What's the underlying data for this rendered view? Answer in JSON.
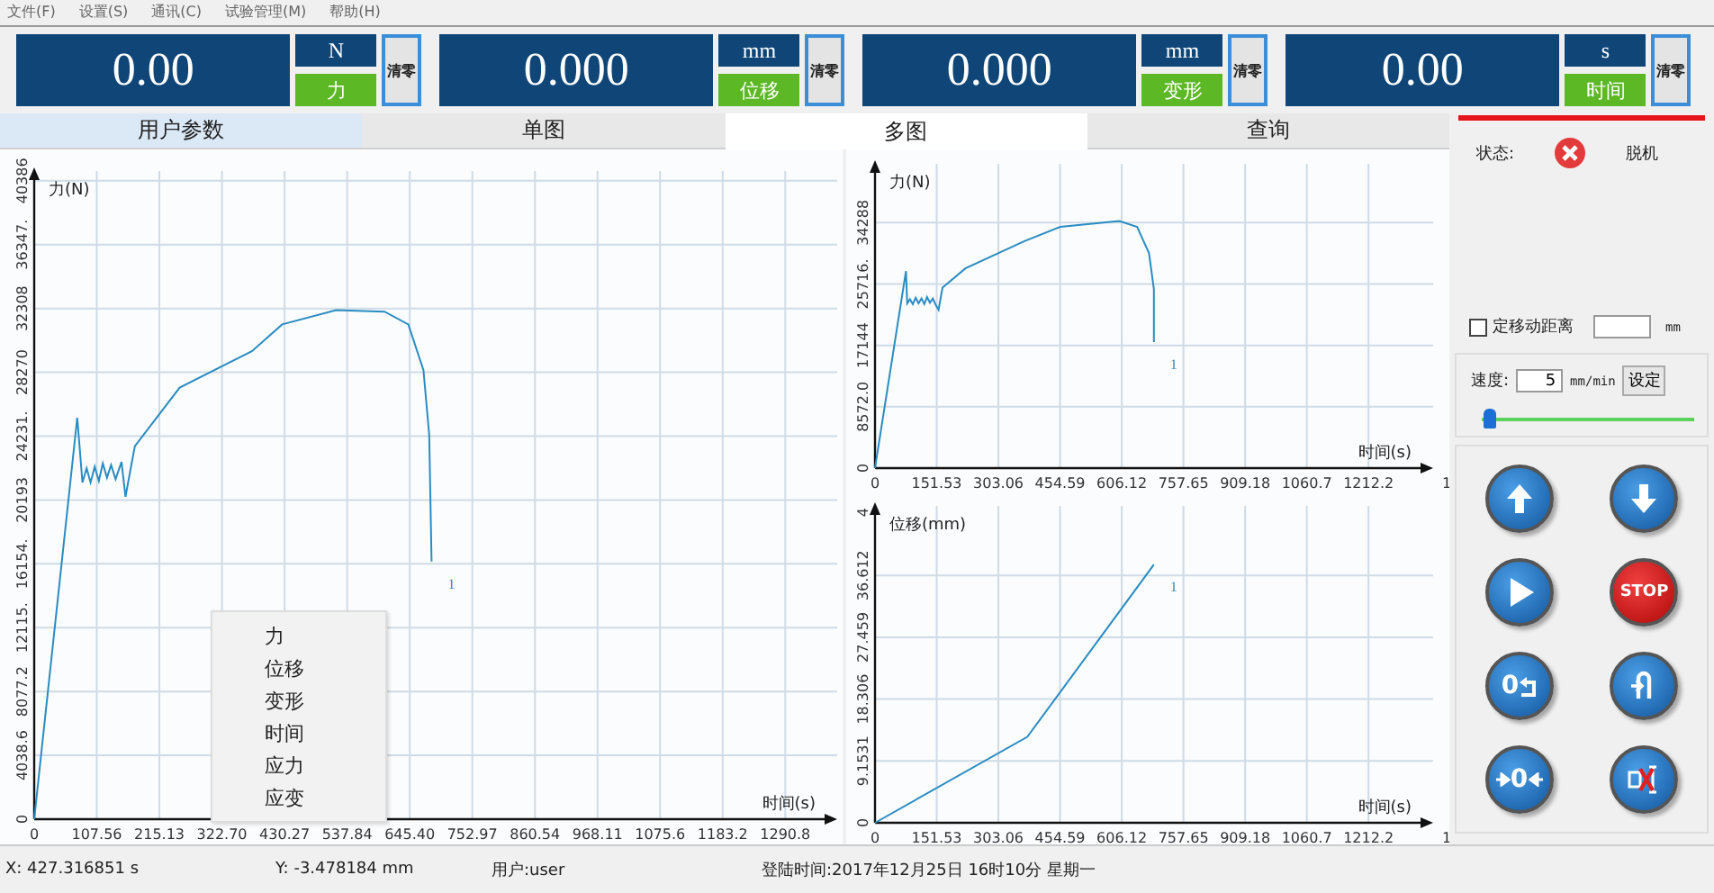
{
  "menu_bar": [
    "文件(F)",
    "设置(S)",
    "通讯(C)",
    "试验管理(M)",
    "帮助(H)"
  ],
  "readouts": [
    {
      "value": "0.00",
      "unit": "N",
      "channel": "力",
      "zero_button": "清零"
    },
    {
      "value": "0.000",
      "unit": "mm",
      "channel": "位移",
      "zero_button": "清零"
    },
    {
      "value": "0.000",
      "unit": "mm",
      "channel": "变形",
      "zero_button": "清零"
    },
    {
      "value": "0.00",
      "unit": "s",
      "channel": "时间",
      "zero_button": "清零"
    }
  ],
  "tabs": [
    {
      "label": "用户参数",
      "selected": false,
      "highlighted": true
    },
    {
      "label": "单图",
      "selected": false,
      "highlighted": false
    },
    {
      "label": "多图",
      "selected": true,
      "highlighted": false
    },
    {
      "label": "查询",
      "selected": false,
      "highlighted": false
    }
  ],
  "main_chart": {
    "chart_data": {
      "type": "line",
      "grid": true,
      "xlabel": "时间(s)",
      "ylabel": "力(N)",
      "xlim": [
        0,
        1380
      ],
      "ylim": [
        0,
        41000
      ],
      "x": [
        0,
        74,
        83,
        90,
        97,
        104,
        111,
        118,
        125,
        132,
        140,
        150,
        157,
        173,
        250,
        374,
        426,
        519,
        602,
        643,
        669,
        679,
        683
      ],
      "series": [
        {
          "name": "1",
          "color": "#2a8cc0",
          "values": [
            0,
            25400,
            21300,
            22200,
            21300,
            22300,
            21400,
            22500,
            21600,
            22400,
            21500,
            22600,
            20400,
            23600,
            27300,
            29600,
            31300,
            32200,
            32100,
            31300,
            28400,
            24300,
            16300
          ]
        }
      ],
      "xticks": [
        0,
        107.56,
        215.13,
        {
          "value": 322.7,
          "label": "322.70"
        },
        430.27,
        537.84,
        {
          "value": 645.4,
          "label": "645.40"
        },
        752.97,
        860.54,
        968.11,
        1075.6,
        1183.2,
        1290.8
      ],
      "yticks": [
        0,
        4038.6,
        8077.2,
        {
          "value": 12115,
          "label": "12115."
        },
        {
          "value": 16154,
          "label": "16154."
        },
        20193,
        {
          "value": 24231,
          "label": "24231."
        },
        28270,
        32308,
        {
          "value": 36347,
          "label": "36347."
        },
        40386
      ]
    }
  },
  "side_charts": [
    {
      "x_edge_label": "1",
      "chart_data": {
        "type": "line",
        "grid": true,
        "xlabel": "时间(s)",
        "ylabel": "力(N)",
        "xlim": [
          0,
          1371
        ],
        "ylim": [
          0,
          42500
        ],
        "x": [
          0,
          76,
          79,
          86,
          93,
          100,
          107,
          114,
          121,
          128,
          135,
          142,
          149,
          156,
          166,
          222,
          367,
          455,
          600,
          644,
          673,
          685,
          685
        ],
        "series": [
          {
            "name": "1",
            "color": "#2a8cc0",
            "values": [
              0,
              27500,
              23000,
              23600,
              22900,
              23800,
              23000,
              23700,
              22900,
              23900,
              23100,
              23700,
              22800,
              22100,
              25200,
              27900,
              31700,
              33700,
              34500,
              33700,
              30000,
              25000,
              17600
            ]
          }
        ],
        "xticks": [
          0,
          151.53,
          303.06,
          454.59,
          606.12,
          757.65,
          909.18,
          1060.7,
          1212.2
        ],
        "yticks": [
          0,
          {
            "value": 8572,
            "label": "8572.0"
          },
          17144,
          {
            "value": 25716,
            "label": "25716."
          },
          34288
        ]
      }
    },
    {
      "x_edge_label": "1",
      "y_edge_label": "4",
      "chart_data": {
        "type": "line",
        "grid": true,
        "xlabel": "时间(s)",
        "ylabel": "位移(mm)",
        "xlim": [
          0,
          1371
        ],
        "ylim": [
          0,
          46.9
        ],
        "x": [
          0,
          374,
          685
        ],
        "series": [
          {
            "name": "1",
            "color": "#2a8cc0",
            "values": [
              0,
              12.7,
              38.2
            ]
          }
        ],
        "xticks": [
          0,
          151.53,
          303.06,
          454.59,
          606.12,
          757.65,
          909.18,
          1060.7,
          1212.2
        ],
        "yticks": [
          0,
          9.1531,
          18.306,
          27.459,
          36.612
        ]
      }
    }
  ],
  "context_menu": {
    "items": [
      "力",
      "位移",
      "变形",
      "时间",
      "应力",
      "应变"
    ]
  },
  "control_panel": {
    "status_label": "状态:",
    "status": "脱机",
    "move_distance": {
      "label": "定移动距离",
      "checked": false,
      "unit": "mm"
    },
    "speed": {
      "label": "速度:",
      "value": "5",
      "unit": "mm/min",
      "button": "设定",
      "level": 0.02
    },
    "buttons": [
      {
        "kind": "up"
      },
      {
        "kind": "down"
      },
      {
        "kind": "start"
      },
      {
        "kind": "stop",
        "label": "STOP"
      },
      {
        "kind": "return",
        "label": "0"
      },
      {
        "kind": "loop"
      },
      {
        "kind": "zero",
        "label": "0"
      },
      {
        "kind": "clear"
      }
    ]
  },
  "status_bar": [
    "X: 427.316851 s",
    "Y: -3.478184 mm",
    "用户:user",
    "登陆时间:2017年12月25日 16时10分 星期一"
  ]
}
